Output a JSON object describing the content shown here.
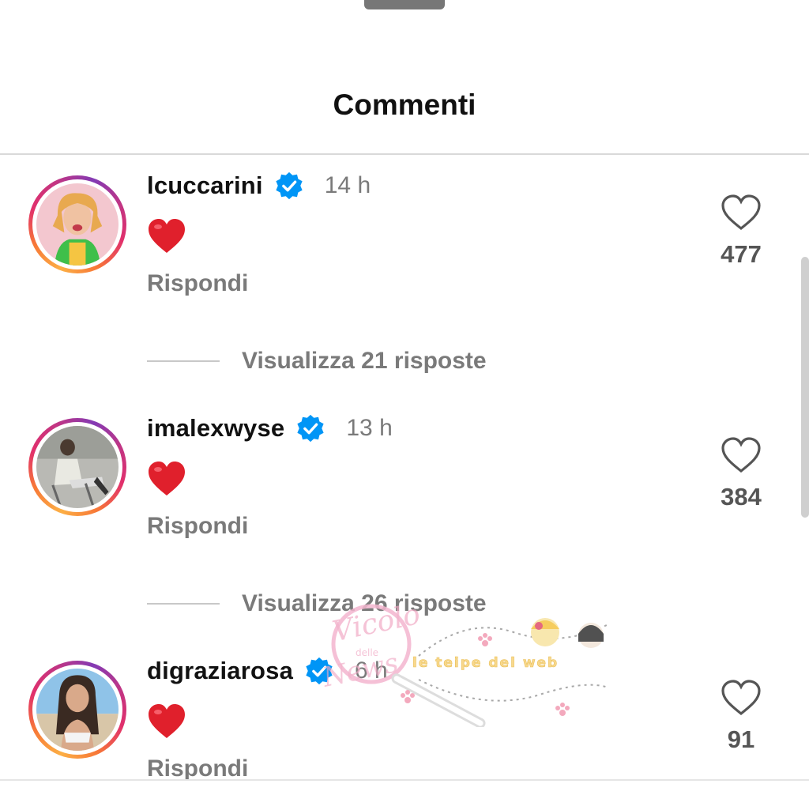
{
  "header": {
    "title": "Commenti"
  },
  "comments": [
    {
      "username": "lcuccarini",
      "time": "14 h",
      "reply": "Rispondi",
      "likes": "477",
      "view_replies": "Visualizza 21 risposte"
    },
    {
      "username": "imalexwyse",
      "time": "13 h",
      "reply": "Rispondi",
      "likes": "384",
      "view_replies": "Visualizza 26 risposte"
    },
    {
      "username": "digraziarosa",
      "time": "6 h",
      "reply": "Rispondi",
      "likes": "91"
    }
  ],
  "watermark": {
    "brand": "Vicolo delle News",
    "tagline": "le teipe del web"
  },
  "colors": {
    "verified": "#0095f6",
    "heart": "#e0202c",
    "muted_text": "#7a7a7a"
  }
}
